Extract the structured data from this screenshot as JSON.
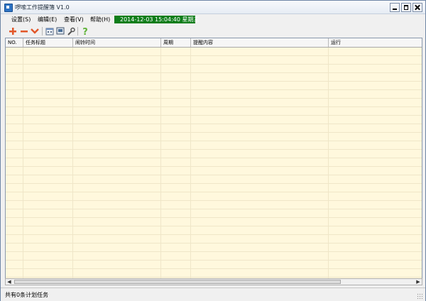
{
  "window": {
    "title": "啰嗦工作提醒簿 V1.0"
  },
  "menubar": {
    "items": [
      "设置(S)",
      "编辑(E)",
      "查看(V)",
      "帮助(H)"
    ],
    "datetime": "2014-12-03 15:04:40  星期三"
  },
  "toolbar": {
    "buttons": [
      {
        "icon": "add-icon",
        "label": "Add"
      },
      {
        "icon": "remove-icon",
        "label": "Remove"
      },
      {
        "icon": "dropdown-icon",
        "label": "More"
      },
      {
        "icon": "calendar-icon",
        "label": "Calendar"
      },
      {
        "icon": "screen-icon",
        "label": "Screen"
      },
      {
        "icon": "wrench-icon",
        "label": "Tools"
      },
      {
        "icon": "help-icon",
        "label": "Help"
      }
    ]
  },
  "grid": {
    "columns": [
      "NO.",
      "任务标题",
      "闹铃时间",
      "周期",
      "提醒内容",
      "运行"
    ],
    "rows": []
  },
  "statusbar": {
    "text": "共有0条计划任务"
  },
  "colors": {
    "datetime_bg": "#0f7d1a",
    "grid_bg": "#fff8dd",
    "add_icon": "#e2572a",
    "help_icon": "#61b33a"
  }
}
